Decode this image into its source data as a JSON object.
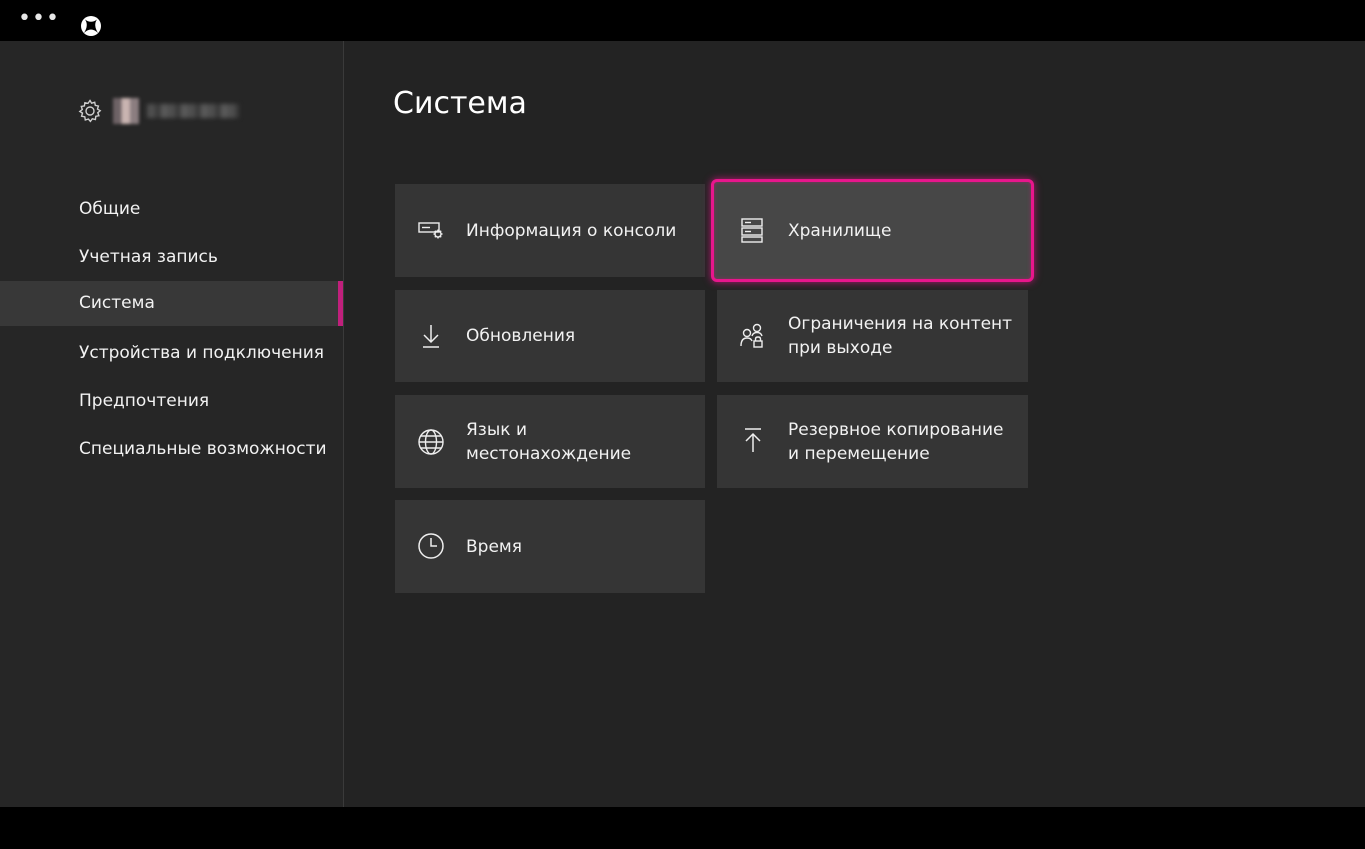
{
  "topbar": {
    "menu_dots": "•••"
  },
  "sidebar": {
    "items": [
      {
        "label": "Общие"
      },
      {
        "label": "Учетная запись"
      },
      {
        "label": "Система",
        "selected": true
      },
      {
        "label": "Устройства и подключения"
      },
      {
        "label": "Предпочтения"
      },
      {
        "label": "Специальные возможности"
      }
    ]
  },
  "main": {
    "title": "Система",
    "tiles": [
      {
        "label": "Информация о консоли",
        "icon": "console-info-icon"
      },
      {
        "label": "Хранилище",
        "icon": "storage-icon",
        "focused": true
      },
      {
        "label": "Обновления",
        "icon": "download-arrow-icon"
      },
      {
        "label": "Ограничения на контент\nпри выходе",
        "icon": "people-lock-icon"
      },
      {
        "label": "Язык и\nместонахождение",
        "icon": "globe-icon"
      },
      {
        "label": "Резервное копирование\nи перемещение",
        "icon": "upload-arrow-icon"
      },
      {
        "label": "Время",
        "icon": "clock-icon"
      }
    ]
  },
  "colors": {
    "accent": "#c0207c",
    "focus_glow": "#e8168c",
    "sidebar_bg": "#262626",
    "main_bg": "#232323",
    "tile_bg": "#353535"
  }
}
